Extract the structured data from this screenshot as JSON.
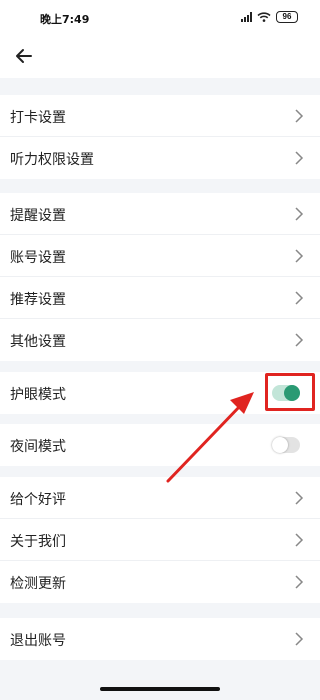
{
  "status_bar": {
    "time": "晚上7:49",
    "battery": "96"
  },
  "settings": {
    "group1": [
      {
        "label": "打卡设置",
        "name": "clock-in"
      },
      {
        "label": "听力权限设置",
        "name": "listening-permission"
      }
    ],
    "group2": [
      {
        "label": "提醒设置",
        "name": "reminder"
      },
      {
        "label": "账号设置",
        "name": "account"
      },
      {
        "label": "推荐设置",
        "name": "recommendation"
      },
      {
        "label": "其他设置",
        "name": "other"
      }
    ],
    "eye_mode": {
      "label": "护眼模式",
      "enabled": true
    },
    "night_mode": {
      "label": "夜间模式",
      "enabled": false
    },
    "group3": [
      {
        "label": "给个好评",
        "name": "rate-us"
      },
      {
        "label": "关于我们",
        "name": "about-us"
      },
      {
        "label": "检测更新",
        "name": "check-update"
      }
    ],
    "logout": {
      "label": "退出账号"
    }
  },
  "colors": {
    "toggle_on": "#2a9a73",
    "annotation": "#e02420"
  }
}
